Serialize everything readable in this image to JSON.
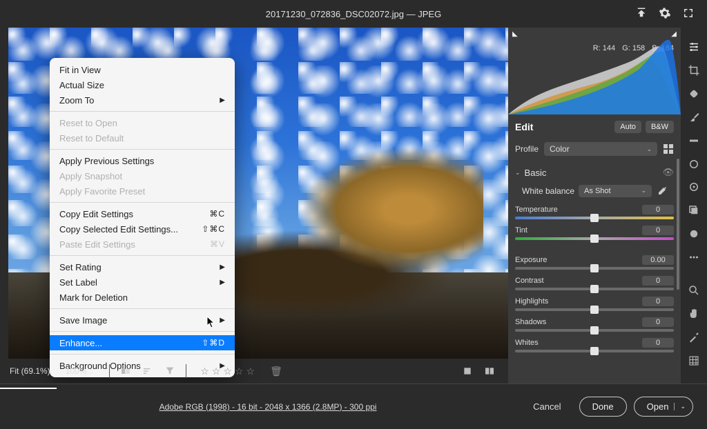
{
  "titlebar": {
    "filename": "20171230_072836_DSC02072.jpg",
    "format_sep": " — ",
    "format": "JPEG"
  },
  "context_menu": {
    "fit_in_view": "Fit in View",
    "actual_size": "Actual Size",
    "zoom_to": "Zoom To",
    "reset_to_open": "Reset to Open",
    "reset_to_default": "Reset to Default",
    "apply_previous": "Apply Previous Settings",
    "apply_snapshot": "Apply Snapshot",
    "apply_favorite": "Apply Favorite Preset",
    "copy_edit": "Copy Edit Settings",
    "copy_edit_kbd": "⌘C",
    "copy_selected": "Copy Selected Edit Settings...",
    "copy_selected_kbd": "⇧⌘C",
    "paste_edit": "Paste Edit Settings",
    "paste_edit_kbd": "⌘V",
    "set_rating": "Set Rating",
    "set_label": "Set Label",
    "mark_deletion": "Mark for Deletion",
    "save_image": "Save Image",
    "enhance": "Enhance...",
    "enhance_kbd": "⇧⌘D",
    "background": "Background Options"
  },
  "canvas_bar": {
    "fit": "Fit (69.1%)",
    "zoom": "100%"
  },
  "histogram": {
    "r": "R: 144",
    "g": "G: 158",
    "b": "B: 184"
  },
  "edit": {
    "title": "Edit",
    "auto": "Auto",
    "bw": "B&W",
    "profile_lbl": "Profile",
    "profile_val": "Color",
    "basic": "Basic",
    "wb_lbl": "White balance",
    "wb_val": "As Shot",
    "sliders": {
      "temperature": {
        "label": "Temperature",
        "value": "0"
      },
      "tint": {
        "label": "Tint",
        "value": "0"
      },
      "exposure": {
        "label": "Exposure",
        "value": "0.00"
      },
      "contrast": {
        "label": "Contrast",
        "value": "0"
      },
      "highlights": {
        "label": "Highlights",
        "value": "0"
      },
      "shadows": {
        "label": "Shadows",
        "value": "0"
      },
      "whites": {
        "label": "Whites",
        "value": "0"
      }
    }
  },
  "footer": {
    "metadata": "Adobe RGB (1998) - 16 bit - 2048 x 1366 (2.8MP) - 300 ppi",
    "cancel": "Cancel",
    "done": "Done",
    "open": "Open"
  }
}
